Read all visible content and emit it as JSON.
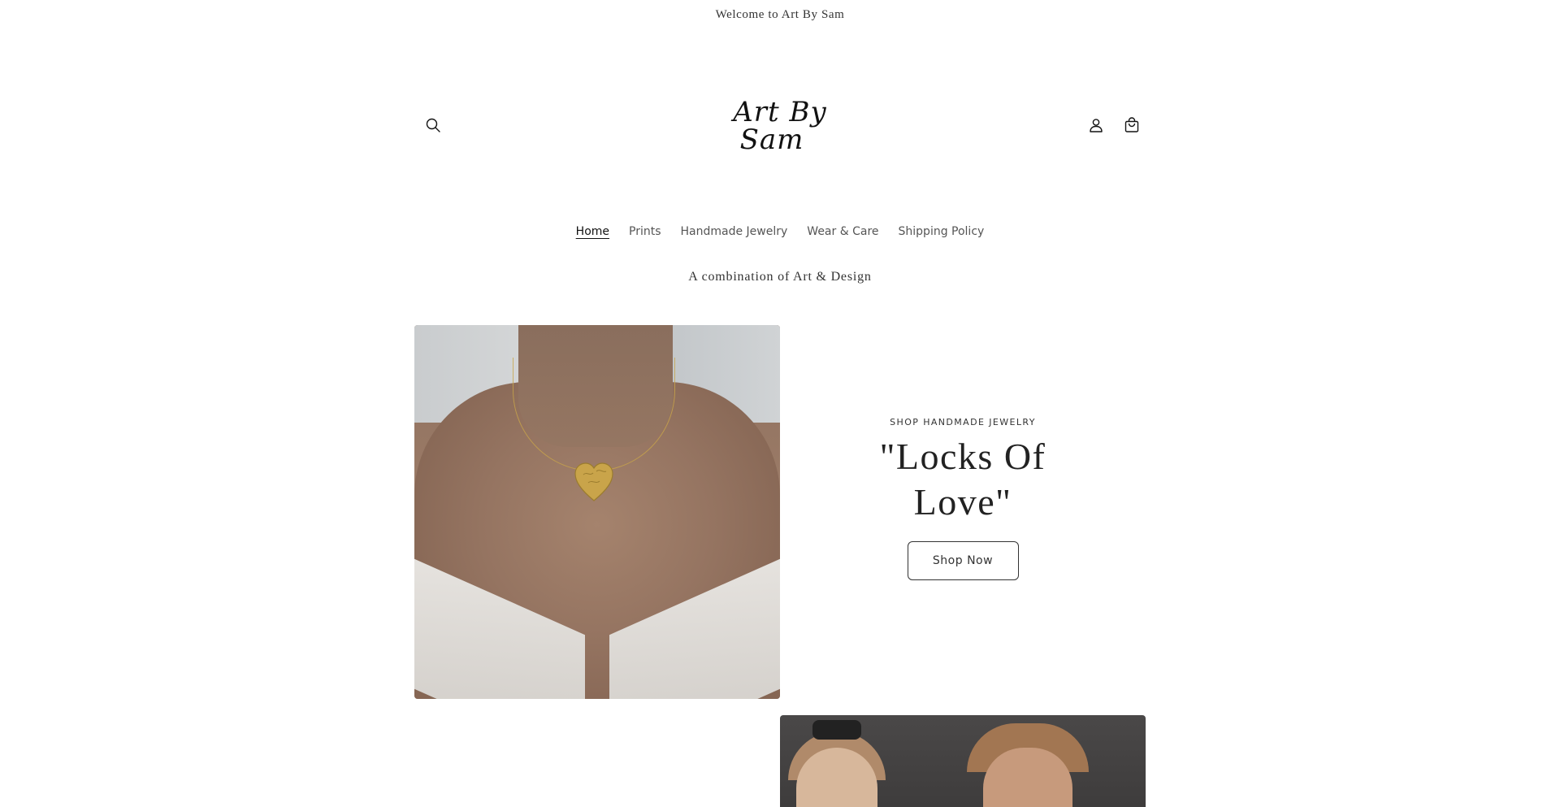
{
  "announcement": {
    "text": "Welcome to Art By Sam"
  },
  "header": {
    "logo_line1": "Art By",
    "logo_line2": "Sam"
  },
  "nav": {
    "items": [
      {
        "label": "Home",
        "active": true
      },
      {
        "label": "Prints"
      },
      {
        "label": "Handmade Jewelry"
      },
      {
        "label": "Wear & Care"
      },
      {
        "label": "Shipping Policy"
      }
    ]
  },
  "tagline": {
    "text": "A combination of Art & Design"
  },
  "hero": {
    "eyebrow": "SHOP HANDMADE JEWELRY",
    "title": "\"Locks Of Love\"",
    "button_label": "Shop Now"
  },
  "colors": {
    "text": "#121212",
    "muted": "#555555",
    "background": "#ffffff",
    "gold": "#c9a54a"
  }
}
